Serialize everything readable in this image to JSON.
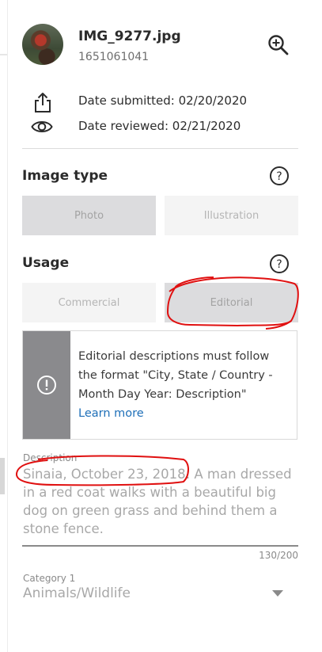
{
  "file": {
    "name": "IMG_9277.jpg",
    "id": "1651061041"
  },
  "meta": {
    "submitted": "Date submitted: 02/20/2020",
    "reviewed": "Date reviewed: 02/21/2020"
  },
  "image_type": {
    "title": "Image type",
    "options": [
      "Photo",
      "Illustration"
    ],
    "selected": "Photo"
  },
  "usage": {
    "title": "Usage",
    "options": [
      "Commercial",
      "Editorial"
    ],
    "selected": "Editorial"
  },
  "notice": {
    "text": "Editorial descriptions must follow the format \"City, State / Country - Month Day Year: Description\"",
    "link": "Learn more"
  },
  "description": {
    "label": "Description",
    "value": "Sinaia, October 23, 2018: A man dressed in a red coat walks with a beautiful big dog on green grass and behind them a stone fence.",
    "counter": "130/200"
  },
  "category": {
    "label": "Category 1",
    "value": "Animals/Wildlife"
  },
  "colors": {
    "annotation": "#e01010",
    "link": "#1e6fb8",
    "notice_bar": "#8a8a8d"
  },
  "icons": [
    "zoom-in-icon",
    "share-icon",
    "eye-icon",
    "help-icon",
    "alert-icon",
    "chevron-down-icon"
  ]
}
